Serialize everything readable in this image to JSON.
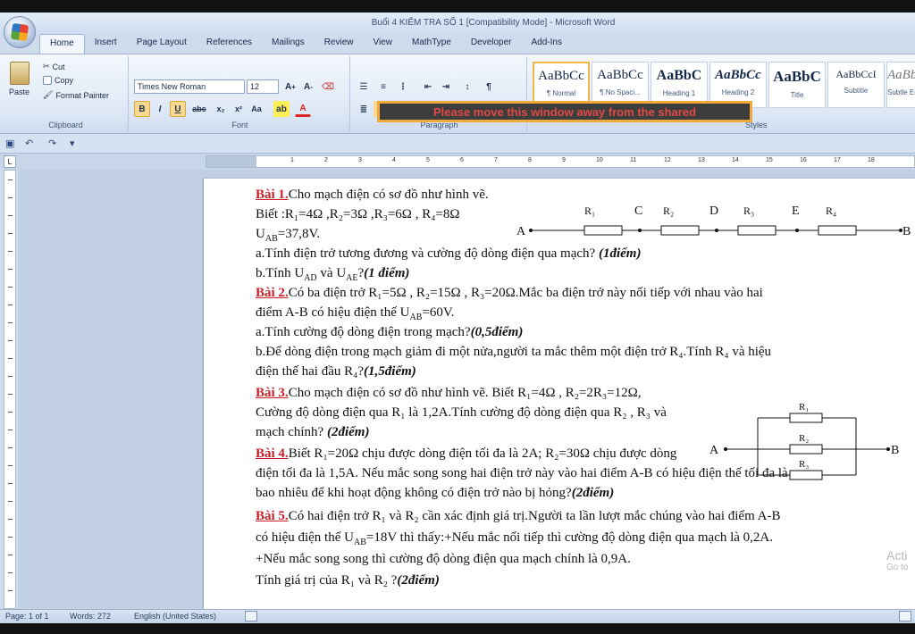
{
  "window": {
    "title": "Buổi 4 KIỂM TRA SỐ 1 [Compatibility Mode] - Microsoft Word"
  },
  "tabs": [
    "Home",
    "Insert",
    "Page Layout",
    "References",
    "Mailings",
    "Review",
    "View",
    "MathType",
    "Developer",
    "Add-Ins"
  ],
  "ribbon": {
    "clipboard": {
      "label": "Clipboard",
      "paste": "Paste",
      "cut": "Cut",
      "copy": "Copy",
      "format_painter": "Format Painter"
    },
    "font": {
      "label": "Font",
      "family": "Times New Roman",
      "size": "12"
    },
    "paragraph": {
      "label": "Paragraph"
    },
    "styles": {
      "label": "Styles",
      "items": [
        {
          "preview": "AaBbCc",
          "name": "¶ Normal"
        },
        {
          "preview": "AaBbCc",
          "name": "¶ No Spaci..."
        },
        {
          "preview": "AaBbC",
          "name": "Heading 1"
        },
        {
          "preview": "AaBbCc",
          "name": "Heading 2"
        },
        {
          "preview": "AaBbC",
          "name": "Title"
        },
        {
          "preview": "AaBbCcI",
          "name": "Subtitle"
        },
        {
          "preview": "AaBbCcDc",
          "name": "Subtle Em..."
        }
      ]
    },
    "share_warning": "Please move this window away from the shared"
  },
  "document": {
    "b1_head": "Bài 1.",
    "b1_l1": "Cho mạch điện có sơ đồ như hình vẽ.",
    "b1_l2": "Biết :R₁=4Ω ,R₂=3Ω ,R₃=6Ω , R₄=8Ω",
    "b1_l3": "U_AB=37,8V.",
    "b1_l4": "a.Tính điện trở tương đương và cường độ dòng điện qua mạch?",
    "b1_l4_pts": "(1điểm)",
    "b1_l5": "b.Tính U_AD và U_AE?",
    "b1_l5_pts": "(1 điểm)",
    "b2_head": "Bài 2.",
    "b2_l1": "Có ba điện trở R₁=5Ω , R₂=15Ω , R₃=20Ω.Mắc ba điện trở này nối tiếp với nhau vào hai",
    "b2_l2": "điểm A-B có hiệu điện thế U_AB=60V.",
    "b2_l3": "a.Tính cường độ dòng điện trong mạch?",
    "b2_l3_pts": "(0,5điểm)",
    "b2_l4": "b.Để dòng điện trong mạch giảm đi một nửa,người ta mắc thêm một điện trở R₄.Tính R₄ và hiệu",
    "b2_l5": "điện thế hai đầu R₄?",
    "b2_l5_pts": "(1,5điểm)",
    "b3_head": "Bài 3.",
    "b3_l1": "Cho mạch điện có sơ đồ như hình vẽ. Biết R₁=4Ω , R₂=2R₃=12Ω,",
    "b3_l2": "Cường độ dòng điện qua R₁ là 1,2A.Tính cường độ dòng điện qua R₂ , R₃ và",
    "b3_l3": "mạch chính?",
    "b3_l3_pts": "(2điểm)",
    "b4_head": "Bài 4.",
    "b4_l1": "Biết R₁=20Ω chịu được dòng điện tối đa là 2A; R₂=30Ω chịu được dòng",
    "b4_l2": "điện tối đa là 1,5A. Nếu mắc song song hai điện trở này vào hai điểm A-B có hiệu điện thế tối đa là",
    "b4_l3": "bao nhiêu để khi hoạt động không có điện trở nào bị hỏng?",
    "b4_l3_pts": "(2điểm)",
    "b5_head": "Bài 5.",
    "b5_l1": "Có hai điện trở R₁ và R₂ cần xác định giá trị.Người ta lần lượt mắc chúng vào hai điểm A-B",
    "b5_l2": "có hiệu điện thế U_AB=18V thì thấy:+Nếu mắc nối tiếp thì cường độ dòng điện qua mạch là 0,2A.",
    "b5_l3": "+Nếu mắc song song thì cường độ dòng điện qua mạch chính là 0,9A.",
    "b5_l4": "Tính giá trị của R₁ và R₂ ?",
    "b5_l4_pts": "(2điểm)"
  },
  "circuit1": {
    "A": "A",
    "B": "B",
    "C": "C",
    "D": "D",
    "E": "E",
    "R1": "R₁",
    "R2": "R₂",
    "R3": "R₃",
    "R4": "R₄"
  },
  "circuit2": {
    "A": "A",
    "B": "B",
    "R1": "R₁",
    "R2": "R₂",
    "R3": "R₃"
  },
  "watermark": {
    "line1": "Acti",
    "line2": "Go to"
  },
  "status": {
    "page": "Page: 1 of 1",
    "words": "Words: 272",
    "language": "English (United States)"
  },
  "colors": {
    "bai_heading": "#c8202a",
    "warning_border": "#f2a83a",
    "warning_text": "#e04a44"
  }
}
